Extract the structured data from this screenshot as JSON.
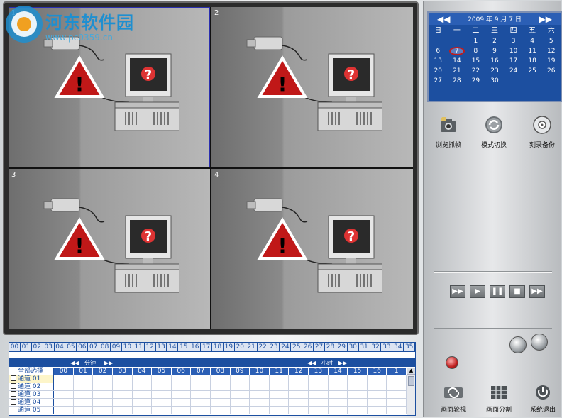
{
  "watermark": {
    "text": "河东软件园",
    "url": "www.pc0359.cn"
  },
  "channels": [
    {
      "num": "1",
      "selected": true
    },
    {
      "num": "2",
      "selected": false
    },
    {
      "num": "3",
      "selected": false
    },
    {
      "num": "4",
      "selected": false
    }
  ],
  "calendar": {
    "prev": "◀◀",
    "next": "▶▶",
    "title": "2009 年 9 月 7 日",
    "weekdays": [
      "日",
      "一",
      "二",
      "三",
      "四",
      "五",
      "六"
    ],
    "days": [
      "",
      "",
      "1",
      "2",
      "3",
      "4",
      "5",
      "6",
      "7",
      "8",
      "9",
      "10",
      "11",
      "12",
      "13",
      "14",
      "15",
      "16",
      "17",
      "18",
      "19",
      "20",
      "21",
      "22",
      "23",
      "24",
      "25",
      "26",
      "27",
      "28",
      "29",
      "30",
      "",
      "",
      ""
    ],
    "selected_day": "7"
  },
  "tools": {
    "browse_capture": "浏览抓帧",
    "mode_switch": "模式切换",
    "burn_backup": "刻录备份"
  },
  "playback": {
    "fast_back": "▶▶",
    "play": "▶",
    "pause": "❚❚",
    "stop": "■",
    "fast_forward": "▶▶"
  },
  "bottom_buttons": {
    "screen_rotate": "画面轮视",
    "screen_split": "画面分割",
    "system_exit": "系统退出"
  },
  "timeline": {
    "hours": [
      "00",
      "01",
      "02",
      "03",
      "04",
      "05",
      "06",
      "07",
      "08",
      "09",
      "10",
      "11",
      "12",
      "13",
      "14",
      "15",
      "16",
      "17",
      "18",
      "19",
      "20",
      "21",
      "22",
      "23",
      "24",
      "25",
      "26",
      "27",
      "28",
      "29",
      "30",
      "31",
      "32",
      "33",
      "34",
      "35"
    ],
    "minute_label": "分钟",
    "hour_label": "小时",
    "select_all": "全部选择",
    "columns": [
      "00",
      "01",
      "02",
      "03",
      "04",
      "05",
      "06",
      "07",
      "08",
      "09",
      "10",
      "11",
      "12",
      "13",
      "14",
      "15",
      "16",
      "1"
    ],
    "rows": [
      "通道 01",
      "通道 02",
      "通道 03",
      "通道 04",
      "通道 05"
    ]
  }
}
